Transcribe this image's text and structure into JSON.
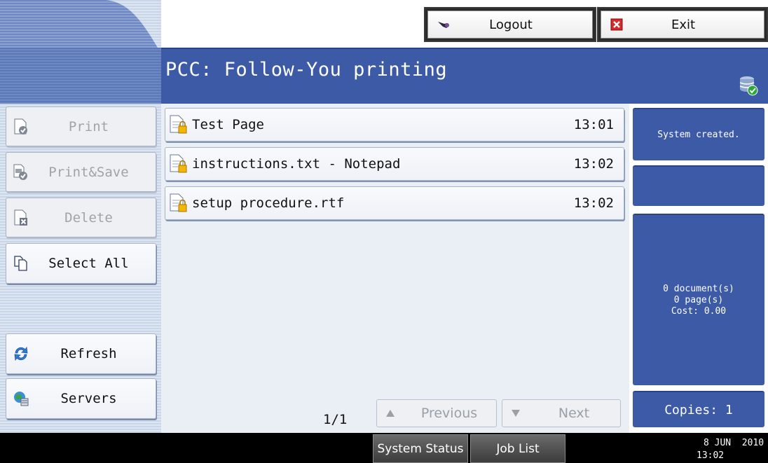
{
  "top_bar": {
    "logout_label": "Logout",
    "exit_label": "Exit",
    "logout_icon": "key-icon",
    "exit_icon": "close-icon"
  },
  "header": {
    "title": "PCC: Follow-You printing",
    "status_icon": "database-check-icon"
  },
  "sidebar": {
    "items": [
      {
        "label": "Print",
        "icon": "print-document-icon",
        "enabled": false
      },
      {
        "label": "Print&Save",
        "icon": "print-save-icon",
        "enabled": false
      },
      {
        "label": "Delete",
        "icon": "delete-document-icon",
        "enabled": false
      },
      {
        "label": "Select All",
        "icon": "select-all-icon",
        "enabled": true
      },
      {
        "label": "Refresh",
        "icon": "refresh-icon",
        "enabled": true
      },
      {
        "label": "Servers",
        "icon": "servers-icon",
        "enabled": true
      }
    ]
  },
  "jobs": [
    {
      "name": "Test Page",
      "time": "13:01"
    },
    {
      "name": "instructions.txt - Notepad",
      "time": "13:02"
    },
    {
      "name": "setup procedure.rtf",
      "time": "13:02"
    }
  ],
  "pager": {
    "page_indicator": "1/1",
    "previous_label": "Previous",
    "next_label": "Next"
  },
  "info_panel": {
    "status": "System created.",
    "summary_documents": "0 document(s)",
    "summary_pages": "0 page(s)",
    "summary_cost": "Cost: 0.00",
    "copies": "Copies: 1"
  },
  "footer": {
    "tabs": [
      "System Status",
      "Job List"
    ],
    "date": "8 JUN  2010",
    "time": "13:02"
  },
  "colors": {
    "accent_blue": "#3d5aa6",
    "panel_background": "#eaeef5",
    "footer_background": "#000000"
  }
}
